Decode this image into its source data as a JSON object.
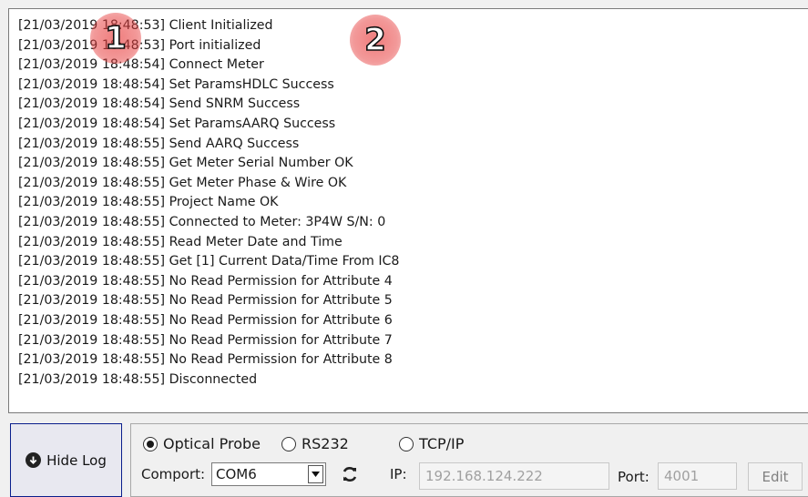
{
  "log": {
    "lines": [
      "[21/03/2019 18:48:53] Client Initialized",
      "[21/03/2019 18:48:53] Port initialized",
      "[21/03/2019 18:48:54] Connect Meter",
      "[21/03/2019 18:48:54] Set ParamsHDLC Success",
      "[21/03/2019 18:48:54] Send SNRM Success",
      "[21/03/2019 18:48:54] Set ParamsAARQ Success",
      "[21/03/2019 18:48:55] Send AARQ Success",
      "[21/03/2019 18:48:55] Get Meter Serial Number OK",
      "[21/03/2019 18:48:55] Get Meter Phase & Wire OK",
      "[21/03/2019 18:48:55] Project Name OK",
      "[21/03/2019 18:48:55] Connected to Meter: 3P4W S/N: 0",
      "[21/03/2019 18:48:55] Read Meter Date and Time",
      "[21/03/2019 18:48:55] Get [1] Current Data/Time From IC8",
      "[21/03/2019 18:48:55] No Read Permission for Attribute 4",
      "[21/03/2019 18:48:55] No Read Permission for Attribute 5",
      "[21/03/2019 18:48:55] No Read Permission for Attribute 6",
      "[21/03/2019 18:48:55] No Read Permission for Attribute 7",
      "[21/03/2019 18:48:55] No Read Permission for Attribute 8",
      "[21/03/2019 18:48:55] Disconnected"
    ]
  },
  "markers": {
    "first": "1",
    "second": "2"
  },
  "hide_log": {
    "label": "Hide Log",
    "icon": "arrow-down-circle-icon"
  },
  "connection": {
    "radios": {
      "optical_probe": {
        "label": "Optical Probe",
        "checked": true
      },
      "rs232": {
        "label": "RS232",
        "checked": false
      },
      "tcpip": {
        "label": "TCP/IP",
        "checked": false
      }
    },
    "comport_label": "Comport:",
    "comport_value": "COM6",
    "ip_label": "IP:",
    "ip_value": "192.168.124.222",
    "port_label": "Port:",
    "port_value": "4001",
    "edit_label": "Edit"
  },
  "colors": {
    "hide_log_border": "#0a1e8c",
    "marker": "#e64646",
    "disabled_text": "#a0a0a0"
  }
}
